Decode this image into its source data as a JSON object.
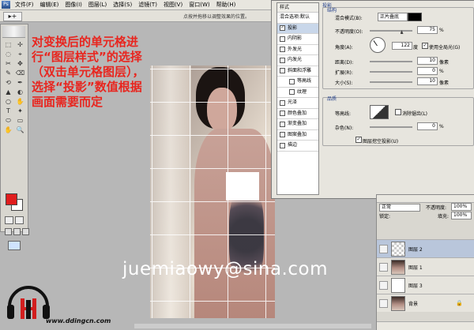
{
  "menubar": {
    "app_icon": "Ps",
    "items": [
      "文件(F)",
      "编辑(E)",
      "图像(I)",
      "图层(L)",
      "选择(S)",
      "滤镜(T)",
      "视图(V)",
      "窗口(W)",
      "帮助(H)"
    ]
  },
  "options_bar": {
    "tool_glyph": "▸+",
    "hint": "点按并拖移以调整效果的位置。"
  },
  "toolbox": {
    "tools": [
      "⬚",
      "✢",
      "◌",
      "⌖",
      "✂",
      "✥",
      "✎",
      "⌫",
      "⟲",
      "✒",
      "▲",
      "◐",
      "○",
      "✋",
      "T",
      "✦",
      "⬭",
      "▭",
      "✋",
      "🔍"
    ],
    "foreground_color": "#e01d1d",
    "background_color": "#ffffff"
  },
  "annotation": {
    "text": "对变换后的单元格进行“图层样式”的选择（双击单元格图层），选择“投影”数值根据画面需要而定",
    "color": "#e8261f"
  },
  "watermark": "juemiaowy@sina.com",
  "site": "www.ddingcn.com",
  "style_dialog": {
    "list_header": "样式",
    "items": [
      {
        "label": "混合选项:默认",
        "checkbox": false,
        "checked": false,
        "selected": false,
        "indent": false
      },
      {
        "label": "投影",
        "checkbox": true,
        "checked": true,
        "selected": true,
        "indent": false
      },
      {
        "label": "内阴影",
        "checkbox": true,
        "checked": false,
        "selected": false,
        "indent": false
      },
      {
        "label": "外发光",
        "checkbox": true,
        "checked": false,
        "selected": false,
        "indent": false
      },
      {
        "label": "内发光",
        "checkbox": true,
        "checked": false,
        "selected": false,
        "indent": false
      },
      {
        "label": "斜面和浮雕",
        "checkbox": true,
        "checked": false,
        "selected": false,
        "indent": false
      },
      {
        "label": "等高线",
        "checkbox": true,
        "checked": false,
        "selected": false,
        "indent": true
      },
      {
        "label": "纹理",
        "checkbox": true,
        "checked": false,
        "selected": false,
        "indent": true
      },
      {
        "label": "光泽",
        "checkbox": true,
        "checked": false,
        "selected": false,
        "indent": false
      },
      {
        "label": "颜色叠加",
        "checkbox": true,
        "checked": false,
        "selected": false,
        "indent": false
      },
      {
        "label": "渐变叠加",
        "checkbox": true,
        "checked": false,
        "selected": false,
        "indent": false
      },
      {
        "label": "图案叠加",
        "checkbox": true,
        "checked": false,
        "selected": false,
        "indent": false
      },
      {
        "label": "描边",
        "checkbox": true,
        "checked": false,
        "selected": false,
        "indent": false
      }
    ],
    "section_title": "投影",
    "structure_title": "结构",
    "blend_mode_label": "混合模式(B):",
    "blend_mode_value": "正片叠底",
    "shadow_color": "#000000",
    "opacity_label": "不透明度(O):",
    "opacity_value": "75",
    "opacity_fraction": 0.75,
    "angle_label": "角度(A):",
    "angle_value": "122",
    "angle_unit": "度",
    "global_light_label": "使用全局光(G)",
    "global_light_checked": true,
    "distance_label": "距离(D):",
    "distance_value": "10",
    "spread_label": "扩展(R):",
    "spread_value": "0",
    "size_label": "大小(S):",
    "size_value": "10",
    "unit_px": "像素",
    "unit_pct": "%",
    "quality_title": "品质",
    "contour_label": "等高线:",
    "antialias_label": "消除锯齿(L)",
    "antialias_checked": false,
    "noise_label": "杂色(N):",
    "noise_value": "0",
    "knockout_label": "图层挖空投影(U)",
    "knockout_checked": true
  },
  "layers_panel": {
    "blend_mode": "正常",
    "opacity_label": "不透明度:",
    "opacity_value": "100%",
    "lock_label": "锁定:",
    "fill_label": "填充:",
    "fill_value": "100%",
    "layers": [
      {
        "name": "图层 2",
        "thumb": "checker",
        "selected": true,
        "locked": false
      },
      {
        "name": "图层 1",
        "thumb": "photo",
        "selected": false,
        "locked": false
      },
      {
        "name": "图层 3",
        "thumb": "white",
        "selected": false,
        "locked": false
      },
      {
        "name": "背景",
        "thumb": "photo",
        "selected": false,
        "locked": true
      }
    ],
    "lock_glyph": "🔒"
  }
}
